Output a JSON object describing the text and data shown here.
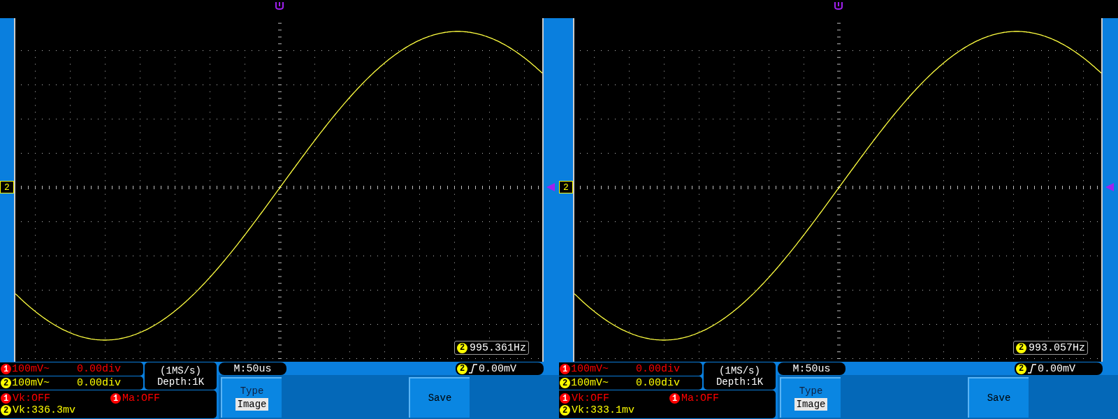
{
  "scopes": [
    {
      "channel_marker": {
        "number": "2",
        "color": "#ffff00"
      },
      "frequency": {
        "channel": "2",
        "value": "995.361Hz"
      },
      "channels": [
        {
          "number": "1",
          "scale": "100mV~",
          "offset": "0.00div",
          "color": "#ff0000"
        },
        {
          "number": "2",
          "scale": "100mV~",
          "offset": "0.00div",
          "color": "#ffff00"
        }
      ],
      "sample_rate": "(1MS/s)",
      "depth": "Depth:1K",
      "timebase": "M:50us",
      "trigger": {
        "channel": "2",
        "level": "0.00mV"
      },
      "measurements": [
        {
          "channel": "1",
          "text": "Vk:OFF"
        },
        {
          "channel": "1",
          "text": "Ma:OFF"
        },
        {
          "channel": "2",
          "text": "Vk:336.3mv"
        }
      ],
      "menu": [
        {
          "kind": "select",
          "label": "Type",
          "value": "Image"
        },
        {
          "kind": "action",
          "label": "Save"
        }
      ]
    },
    {
      "channel_marker": {
        "number": "2",
        "color": "#ffff00"
      },
      "frequency": {
        "channel": "2",
        "value": "993.057Hz"
      },
      "channels": [
        {
          "number": "1",
          "scale": "100mV~",
          "offset": "0.00div",
          "color": "#ff0000"
        },
        {
          "number": "2",
          "scale": "100mV~",
          "offset": "0.00div",
          "color": "#ffff00"
        }
      ],
      "sample_rate": "(1MS/s)",
      "depth": "Depth:1K",
      "timebase": "M:50us",
      "trigger": {
        "channel": "2",
        "level": "0.00mV"
      },
      "measurements": [
        {
          "channel": "1",
          "text": "Vk:OFF"
        },
        {
          "channel": "1",
          "text": "Ma:OFF"
        },
        {
          "channel": "2",
          "text": "Vk:333.1mv"
        }
      ],
      "menu": [
        {
          "kind": "select",
          "label": "Type",
          "value": "Image"
        },
        {
          "kind": "action",
          "label": "Save"
        }
      ]
    }
  ]
}
